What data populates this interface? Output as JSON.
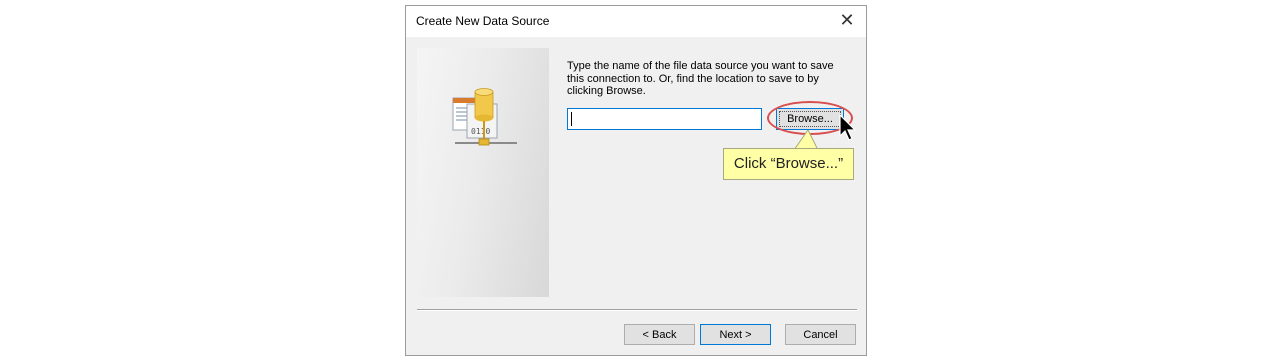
{
  "dialog": {
    "title": "Create New Data Source",
    "close_label": "✕",
    "instructions": "Type the name of the file data source you want to save this connection to.  Or, find the location to save to by clicking Browse.",
    "filename_value": "",
    "browse_label": "Browse...",
    "back_label": "< Back",
    "next_label": "Next >",
    "cancel_label": "Cancel"
  },
  "annotation": {
    "callout_text": "Click “Browse...”",
    "highlight_color": "#d94f4f",
    "callout_bg": "#ffffa6"
  },
  "icons": {
    "side": "data-source-file-icon",
    "cursor": "mouse-pointer-icon",
    "close": "close-icon"
  }
}
